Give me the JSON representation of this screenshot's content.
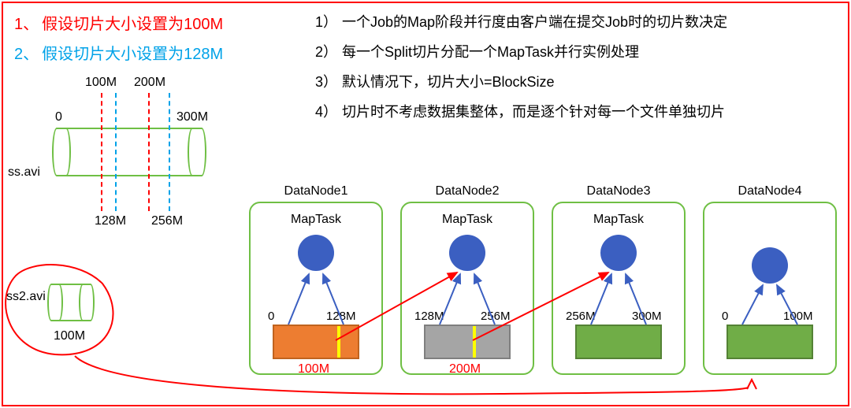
{
  "assumptions": {
    "a1_num": "1、",
    "a1_text": "假设切片大小设置为100M",
    "a2_num": "2、",
    "a2_text": "假设切片大小设置为128M"
  },
  "notes": {
    "n1_num": "1）",
    "n1_text": "一个Job的Map阶段并行度由客户端在提交Job时的切片数决定",
    "n2_num": "2）",
    "n2_text": "每一个Split切片分配一个MapTask并行实例处理",
    "n3_num": "3）",
    "n3_text": "默认情况下，切片大小=BlockSize",
    "n4_num": "4）",
    "n4_text": "切片时不考虑数据集整体，而是逐个针对每一个文件单独切片"
  },
  "cylinder": {
    "file1": "ss.avi",
    "file2": "ss2.avi",
    "file2_size": "100M",
    "zero": "0",
    "end": "300M",
    "red1": "100M",
    "red2": "200M",
    "blue1": "128M",
    "blue2": "256M"
  },
  "datanodes": {
    "dn1_title": "DataNode1",
    "dn2_title": "DataNode2",
    "dn3_title": "DataNode3",
    "dn4_title": "DataNode4",
    "maptask": "MapTask",
    "dn1_l": "0",
    "dn1_r": "128M",
    "dn1_split": "100M",
    "dn2_l": "128M",
    "dn2_r": "256M",
    "dn2_split": "200M",
    "dn3_l": "256M",
    "dn3_r": "300M",
    "dn4_l": "0",
    "dn4_r": "100M"
  },
  "colors": {
    "red": "#ff0000",
    "blue": "#00a2e8",
    "green_border": "#6fbf44",
    "circle": "#3b5fc1",
    "orange": "#ed7d31",
    "gray": "#a5a5a5",
    "green_fill": "#70ad47"
  }
}
